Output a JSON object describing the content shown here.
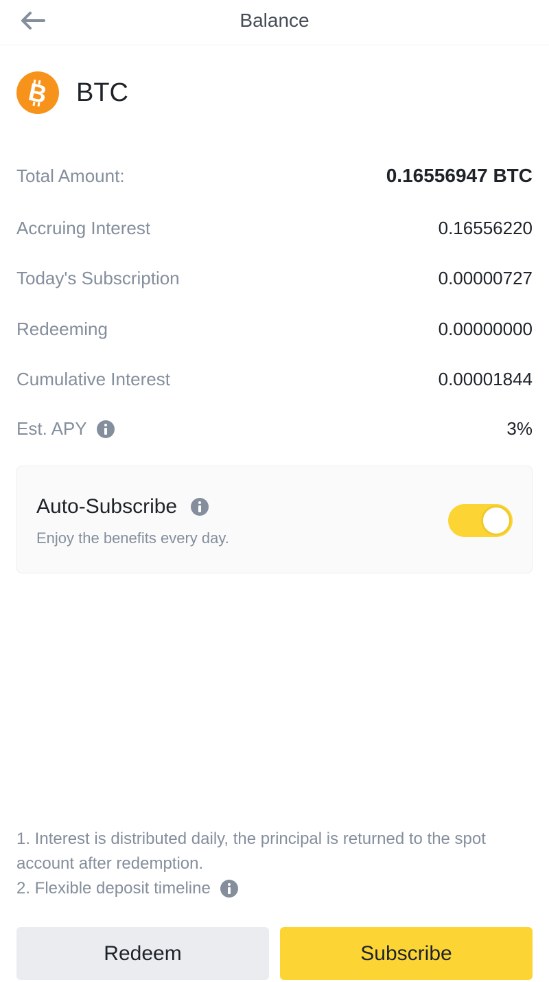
{
  "header": {
    "title": "Balance",
    "back_icon": "arrow-left-icon"
  },
  "asset": {
    "symbol": "BTC",
    "icon": "bitcoin-icon",
    "brand_color": "#f7931a"
  },
  "details": [
    {
      "label": "Total Amount:",
      "value": "0.16556947 BTC"
    },
    {
      "label": "Accruing Interest",
      "value": "0.16556220"
    },
    {
      "label": "Today's Subscription",
      "value": "0.00000727"
    },
    {
      "label": "Redeeming",
      "value": "0.00000000"
    },
    {
      "label": "Cumulative Interest",
      "value": "0.00001844"
    },
    {
      "label": "Est. APY",
      "value": "3%",
      "has_info": true
    }
  ],
  "auto_subscribe": {
    "title": "Auto-Subscribe",
    "subtitle": "Enjoy the benefits every day.",
    "enabled": true,
    "accent_color": "#fcd535"
  },
  "notes": {
    "line1": "1. Interest is distributed daily, the principal is returned to the spot account after redemption.",
    "line2": "2. Flexible deposit timeline"
  },
  "buttons": {
    "redeem": "Redeem",
    "subscribe": "Subscribe"
  }
}
